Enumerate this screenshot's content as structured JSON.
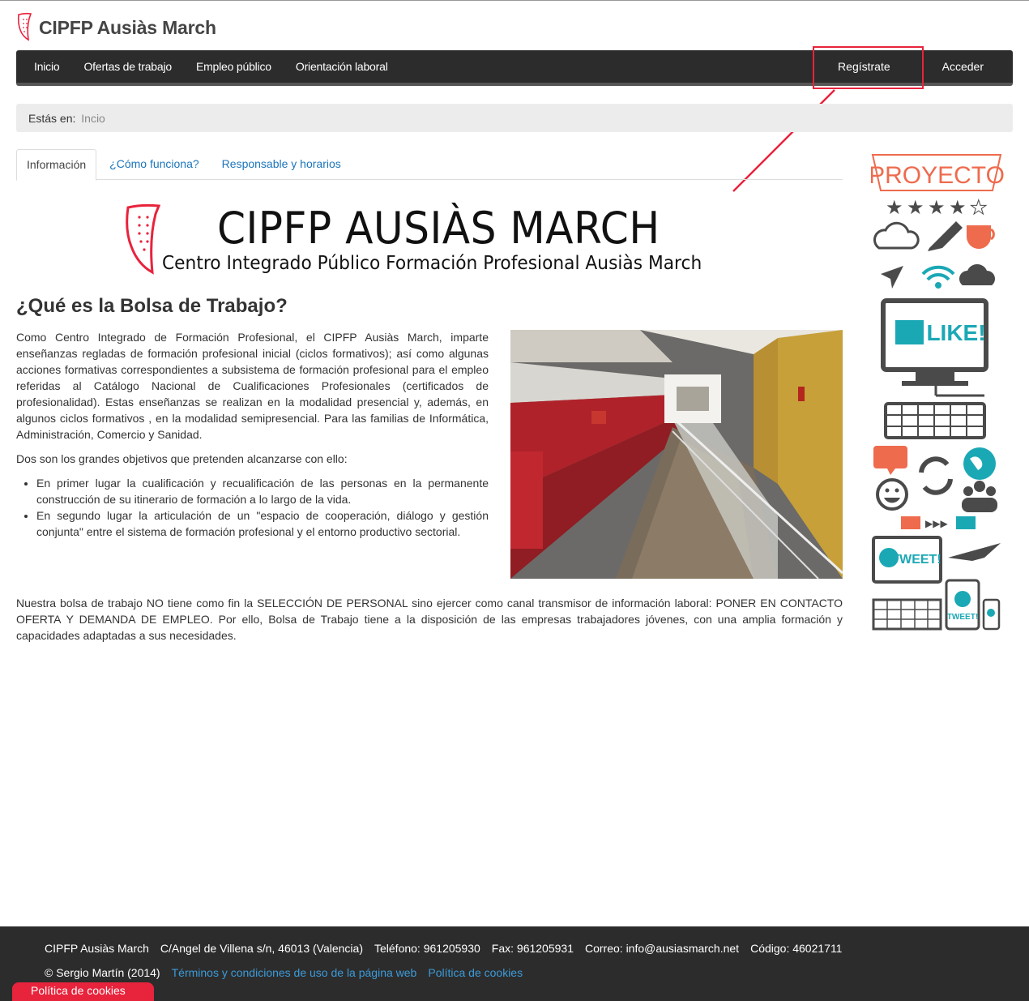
{
  "header": {
    "title": "CIPFP Ausiàs March"
  },
  "nav": {
    "items": [
      "Inicio",
      "Ofertas de trabajo",
      "Empleo público",
      "Orientación laboral"
    ],
    "register": "Regístrate",
    "login": "Acceder"
  },
  "breadcrumb": {
    "prefix": "Estás en:",
    "current": "Incio"
  },
  "tabs": [
    "Información",
    "¿Cómo funciona?",
    "Responsable y horarios"
  ],
  "banner": {
    "title": "CIPFP AUSIÀS MARCH",
    "subtitle": "Centro Integrado Público Formación Profesional Ausiàs March"
  },
  "content": {
    "heading": "¿Qué es la Bolsa de Trabajo?",
    "paragraph1": "Como Centro Integrado de Formación Profesional, el CIPFP Ausiàs March, imparte enseñanzas regladas de formación profesional inicial (ciclos formativos); así como algunas acciones formativas correspondientes a subsistema de formación profesional para el empleo referidas al Catálogo Nacional de Cualificaciones Profesionales (certificados de profesionalidad). Estas enseñanzas se realizan en la modalidad presencial y, además, en algunos ciclos formativos , en la modalidad semipresencial. Para las familias de Informática, Administración, Comercio y Sanidad.",
    "paragraph2": "Dos son los grandes objetivos que pretenden alcanzarse con ello:",
    "bullets": [
      "En primer lugar la cualificación y recualificación de las personas en la permanente construcción de su itinerario de formación a lo largo de la vida.",
      "En segundo lugar la articulación de un \"espacio de cooperación, diálogo y gestión conjunta\" entre el sistema de formación profesional y el entorno productivo sectorial."
    ],
    "paragraph3": "Nuestra bolsa de trabajo NO tiene como fin la SELECCIÓN DE PERSONAL sino ejercer como canal transmisor de información laboral: PONER EN CONTACTO OFERTA Y DEMANDA DE EMPLEO. Por ello, Bolsa de Trabajo tiene a la disposición de las empresas trabajadores jóvenes, con una amplia formación y capacidades adaptadas a sus necesidades."
  },
  "sidebar": {
    "proyecto": "PROYECTO",
    "like": "LIKE!",
    "tweet1": "TWEET!",
    "tweet2": "TWEET!"
  },
  "footer": {
    "name": "CIPFP Ausiàs March",
    "address": "C/Angel de Villena s/n, 46013 (Valencia)",
    "phone": "Teléfono: 961205930",
    "fax": "Fax: 961205931",
    "email": "Correo: info@ausiasmarch.net",
    "code": "Código: 46021711",
    "copyright": "© Sergio Martín (2014)",
    "terms_link": "Términos y condiciones de uso de la página web",
    "cookies_link": "Política de cookies",
    "cookie_tab": "Política de cookies"
  },
  "colors": {
    "accent": "#e8233c",
    "navbar": "#2c2c2c",
    "link": "#1b75bb"
  }
}
